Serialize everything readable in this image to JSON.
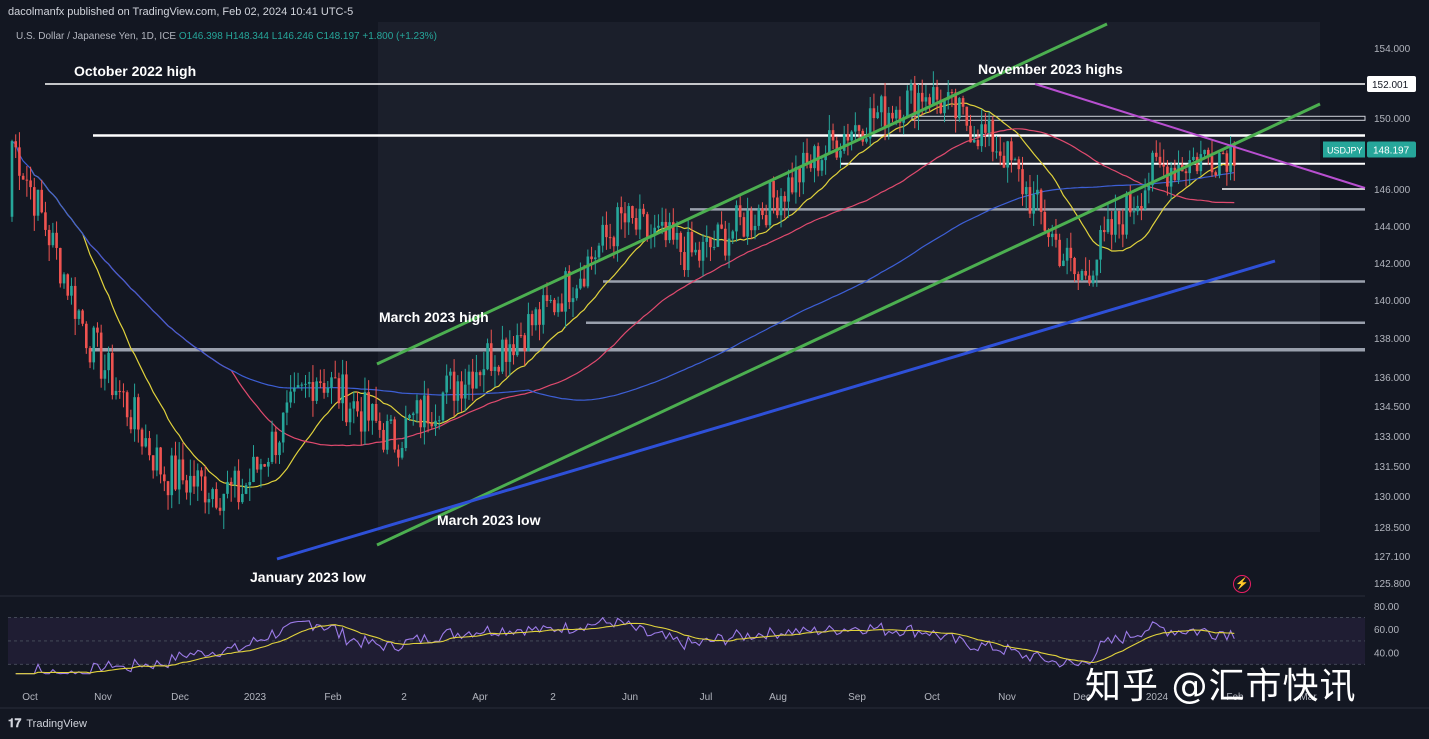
{
  "header": {
    "publisher": "dacolmanfx published on TradingView.com, Feb 02, 2024 10:41 UTC-5"
  },
  "symbol_line": {
    "name": "U.S. Dollar / Japanese Yen, 1D, ICE",
    "open": "O146.398",
    "high": "H148.344",
    "low": "L146.246",
    "close": "C148.197",
    "change": "+1.800 (+1.23%)"
  },
  "price_tag": {
    "symbol": "USDJPY",
    "price": "148.197"
  },
  "hline_tag": "152.001",
  "footer": {
    "brand": "TradingView"
  },
  "watermark": "知乎 @汇市快讯",
  "colors": {
    "background": "#131722",
    "up": "#26a69a",
    "down": "#ef5350",
    "ma_yellow": "#e0d23c",
    "ma_red": "#e04a6e",
    "ma_blue": "#3d5fd6",
    "channel_green": "#4caf50",
    "trend_blue": "#2e50d8",
    "trend_purple": "#b84fd0",
    "rsi_line": "#9c7be8"
  },
  "chart_data": [
    {
      "type": "candlestick",
      "ylim": [
        124.9,
        155.5
      ],
      "price_ticks": [
        154.0,
        152.0,
        150.0,
        148.0,
        146.0,
        144.0,
        142.0,
        140.0,
        138.0,
        136.0,
        134.5,
        133.0,
        131.5,
        130.0,
        128.5,
        127.1,
        125.8
      ],
      "time_ticks": [
        "Oct",
        "Nov",
        "Dec",
        "2023",
        "Feb",
        "2",
        "Apr",
        "2",
        "Jun",
        "Jul",
        "Aug",
        "Sep",
        "Oct",
        "Nov",
        "Dec",
        "2024",
        "Feb",
        "Mar"
      ],
      "approx_monthly_closes": [
        {
          "month": "Oct 2022",
          "close": 148.7
        },
        {
          "month": "Nov 2022",
          "close": 138.0
        },
        {
          "month": "Dec 2022",
          "close": 131.1
        },
        {
          "month": "Jan 2023",
          "close": 130.1
        },
        {
          "month": "Feb 2023",
          "close": 136.2
        },
        {
          "month": "Mar 2023",
          "close": 132.8
        },
        {
          "month": "Apr 2023",
          "close": 136.3
        },
        {
          "month": "May 2023",
          "close": 139.3
        },
        {
          "month": "Jun 2023",
          "close": 144.3
        },
        {
          "month": "Jul 2023",
          "close": 142.3
        },
        {
          "month": "Aug 2023",
          "close": 145.5
        },
        {
          "month": "Sep 2023",
          "close": 149.4
        },
        {
          "month": "Oct 2023",
          "close": 151.6
        },
        {
          "month": "Nov 2023",
          "close": 148.2
        },
        {
          "month": "Dec 2023",
          "close": 141.0
        },
        {
          "month": "Jan 2024",
          "close": 147.0
        },
        {
          "month": "Feb 2024",
          "close": 148.197
        }
      ],
      "horizontal_levels": [
        152.0,
        149.0,
        147.4,
        146.0,
        144.9,
        141.0,
        138.8,
        137.4
      ],
      "annotations": [
        "October 2022 high",
        "November 2023 highs",
        "March 2023 high",
        "March 2023 low",
        "January 2023 low"
      ],
      "series": [
        {
          "name": "",
          "kind": "moving-average",
          "color": "#e0d23c"
        },
        {
          "name": "",
          "kind": "moving-average",
          "color": "#e04a6e"
        },
        {
          "name": "",
          "kind": "moving-average",
          "color": "#3d5fd6"
        }
      ]
    },
    {
      "type": "line",
      "ylim": [
        20,
        85
      ],
      "y_ticks": [
        80.0,
        60.0,
        40.0
      ],
      "series": [
        {
          "name": "",
          "kind": "rsi",
          "color": "#9c7be8"
        },
        {
          "name": "",
          "kind": "signal",
          "color": "#e0d23c"
        }
      ]
    }
  ]
}
